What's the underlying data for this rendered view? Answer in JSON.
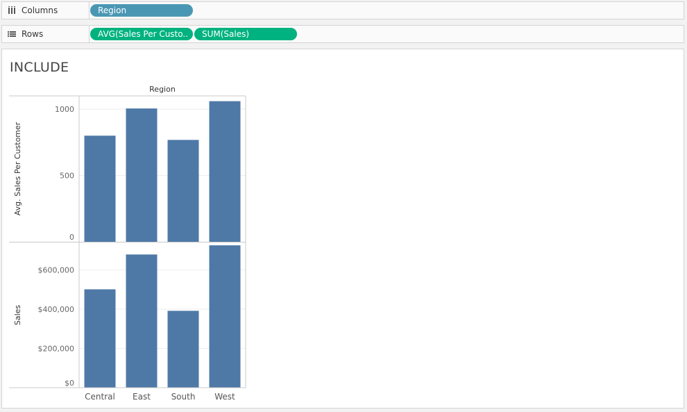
{
  "shelves": {
    "columns": {
      "label": "Columns",
      "icon": "columns-icon",
      "pills": [
        {
          "label": "Region",
          "kind": "dimension"
        }
      ]
    },
    "rows": {
      "label": "Rows",
      "icon": "rows-icon",
      "pills": [
        {
          "label": "AVG(Sales Per Custo..",
          "kind": "measure"
        },
        {
          "label": "SUM(Sales)",
          "kind": "measure"
        }
      ]
    }
  },
  "sheet": {
    "title": "INCLUDE"
  },
  "colors": {
    "dimension_pill": "#4a97b4",
    "measure_pill": "#00b27f",
    "bar": "#4e79a7"
  },
  "chart_data": {
    "type": "bar",
    "column_header": "Region",
    "categories": [
      "Central",
      "East",
      "South",
      "West"
    ],
    "grid": true,
    "panes": [
      {
        "ylabel": "Avg. Sales Per Customer",
        "ylim": [
          0,
          1100
        ],
        "ticks": [
          {
            "value": 0,
            "label": "0"
          },
          {
            "value": 500,
            "label": "500"
          },
          {
            "value": 1000,
            "label": "1000"
          }
        ],
        "values": [
          800,
          1005,
          768,
          1060
        ]
      },
      {
        "ylabel": "Sales",
        "ylim": [
          0,
          740000
        ],
        "ticks": [
          {
            "value": 0,
            "label": "$0"
          },
          {
            "value": 200000,
            "label": "$200,000"
          },
          {
            "value": 400000,
            "label": "$400,000"
          },
          {
            "value": 600000,
            "label": "$600,000"
          }
        ],
        "values": [
          501240,
          678781,
          391722,
          725458
        ]
      }
    ]
  }
}
